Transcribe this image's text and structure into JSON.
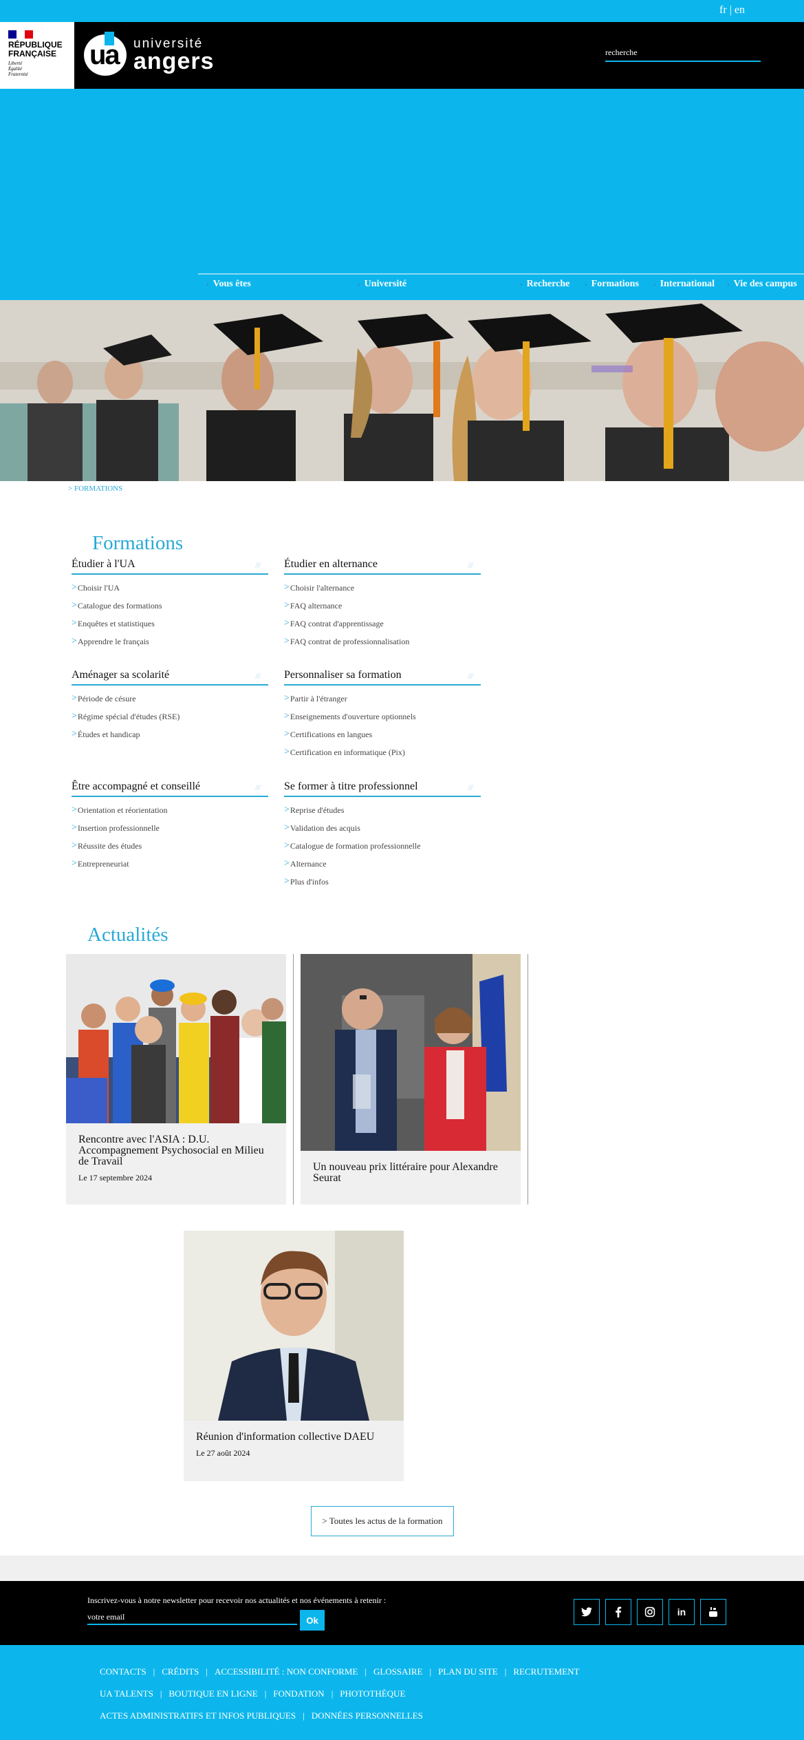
{
  "lang": {
    "fr": "fr",
    "sep": "|",
    "en": "en"
  },
  "header": {
    "rf_title_1": "RÉPUBLIQUE",
    "rf_title_2": "FRANÇAISE",
    "rf_motto_1": "Liberté",
    "rf_motto_2": "Égalité",
    "rf_motto_3": "Fraternité",
    "logo_small": "université",
    "logo_big": "angers",
    "search_placeholder": "recherche"
  },
  "nav": [
    {
      "label": "Vous êtes"
    },
    {
      "label": "Université"
    },
    {
      "label": "Recherche"
    },
    {
      "label": "Formations"
    },
    {
      "label": "International"
    },
    {
      "label": "Vie des campus"
    }
  ],
  "breadcrumb": "> FORMATIONS",
  "formations": {
    "title": "Formations",
    "blocks": [
      {
        "title": "Étudier à l'UA",
        "mark": "///",
        "items": [
          "Choisir l'UA",
          "Catalogue des formations",
          "Enquêtes et statistiques",
          "Apprendre le français"
        ]
      },
      {
        "title": "Étudier en alternance",
        "mark": "///",
        "items": [
          "Choisir l'alternance",
          "FAQ alternance",
          "FAQ contrat d'apprentissage",
          "FAQ contrat de professionnalisation"
        ]
      },
      {
        "title": "Aménager sa scolarité",
        "mark": "///",
        "items": [
          "Période de césure",
          "Régime spécial d'études (RSE)",
          "Études et handicap"
        ]
      },
      {
        "title": "Personnaliser sa formation",
        "mark": "///",
        "items": [
          "Partir à l'étranger",
          "Enseignements d'ouverture optionnels",
          "Certifications en langues",
          "Certification en informatique (Pix)"
        ]
      },
      {
        "title": "Être accompagné et conseillé",
        "mark": "///",
        "items": [
          "Orientation et réorientation",
          "Insertion professionnelle",
          "Réussite des études",
          "Entrepreneuriat"
        ]
      },
      {
        "title": "Se former à titre professionnel",
        "mark": "///",
        "items": [
          "Reprise d'études",
          "Validation des acquis",
          "Catalogue de formation professionnelle",
          "Alternance",
          "Plus d'infos"
        ]
      }
    ]
  },
  "actus": {
    "title": "Actualités",
    "cards": [
      {
        "title": "Rencontre avec l'ASIA : D.U. Accompagnement Psychosocial en Milieu de Travail",
        "date": "Le 17 septembre 2024"
      },
      {
        "title": "Un nouveau prix littéraire pour Alexandre Seurat",
        "date": ""
      },
      {
        "title": "Réunion d'information collective DAEU",
        "date": "Le 27 août 2024"
      }
    ],
    "all_button": "> Toutes les actus de la formation"
  },
  "newsletter": {
    "label": "Inscrivez-vous à notre newsletter pour recevoir nos actualités et nos événements à retenir :",
    "placeholder": "votre email",
    "ok": "Ok"
  },
  "social": [
    "twitter-icon",
    "facebook-icon",
    "instagram-icon",
    "linkedin-icon",
    "youtube-icon"
  ],
  "footer": {
    "row1": [
      "CONTACTS",
      "CRÉDITS",
      "ACCESSIBILITÉ : NON CONFORME",
      "GLOSSAIRE",
      "PLAN DU SITE",
      "RECRUTEMENT"
    ],
    "row2": [
      "UA TALENTS",
      "BOUTIQUE EN LIGNE",
      "FONDATION",
      "PHOTOTHÈQUE"
    ],
    "row3": [
      "ACTES ADMINISTRATIFS ET INFOS PUBLIQUES",
      "DONNÉES PERSONNELLES"
    ]
  },
  "colors": {
    "accent": "#0cb6ec",
    "link": "#29a9d5",
    "header_bg": "#000000"
  }
}
